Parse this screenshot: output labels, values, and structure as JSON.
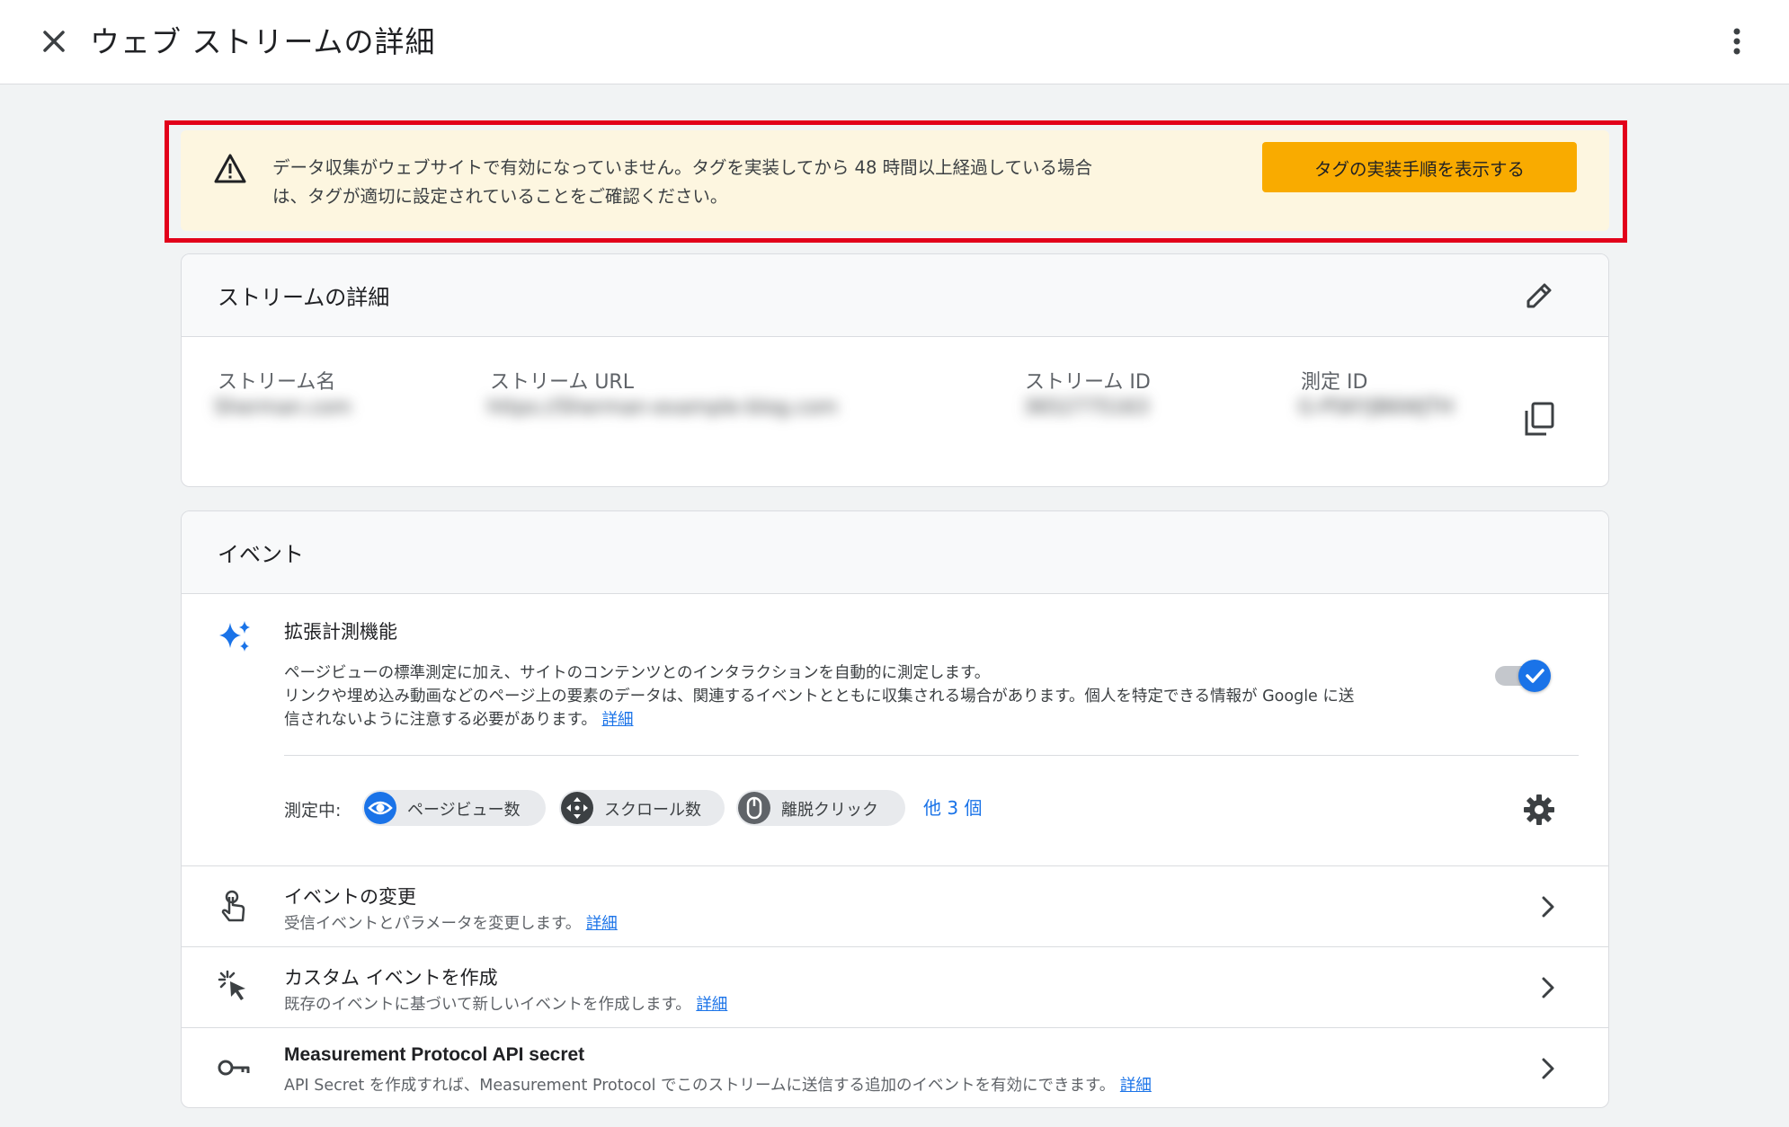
{
  "header": {
    "title": "ウェブ ストリームの詳細"
  },
  "banner": {
    "text_line1": "データ収集がウェブサイトで有効になっていません。タグを実装してから 48 時間以上経過している場合",
    "text_line2": "は、タグが適切に設定されていることをご確認ください。",
    "button_label": "タグの実装手順を表示する",
    "colors": {
      "background": "#fdf6e0",
      "button": "#f9ab00",
      "highlight_border": "#e2001a"
    }
  },
  "stream_details": {
    "title": "ストリームの詳細",
    "fields": [
      {
        "label": "ストリーム名",
        "value": "Sherman.com"
      },
      {
        "label": "ストリーム URL",
        "value": "https://Sherman-example-blog.com"
      },
      {
        "label": "ストリーム ID",
        "value": "3652775163"
      },
      {
        "label": "測定 ID",
        "value": "G-PSKYJB6WJTH"
      }
    ]
  },
  "events": {
    "title": "イベント",
    "enhanced": {
      "title": "拡張計測機能",
      "desc_line1": "ページビューの標準測定に加え、サイトのコンテンツとのインタラクションを自動的に測定します。",
      "desc_line2": "リンクや埋め込み動画などのページ上の要素のデータは、関連するイベントとともに収集される場合があります。個人を特定できる情報が Google に送",
      "desc_line3": "信されないように注意する必要があります。",
      "learn_more": "詳細",
      "toggle_on": true,
      "measuring_label": "測定中:",
      "chips": [
        {
          "label": "ページビュー数",
          "icon": "eye-icon"
        },
        {
          "label": "スクロール数",
          "icon": "scroll-icon"
        },
        {
          "label": "離脱クリック",
          "icon": "mouse-icon"
        }
      ],
      "more_label": "他 3 個"
    },
    "rows": [
      {
        "title": "イベントの変更",
        "desc": "受信イベントとパラメータを変更します。",
        "link": "詳細",
        "icon": "touch-icon"
      },
      {
        "title": "カスタム イベントを作成",
        "desc": "既存のイベントに基づいて新しいイベントを作成します。",
        "link": "詳細",
        "icon": "click-icon"
      },
      {
        "title": "Measurement Protocol API secret",
        "desc": "API Secret を作成すれば、Measurement Protocol でこのストリームに送信する追加のイベントを有効にできます。",
        "link": "詳細",
        "icon": "key-icon"
      }
    ]
  }
}
